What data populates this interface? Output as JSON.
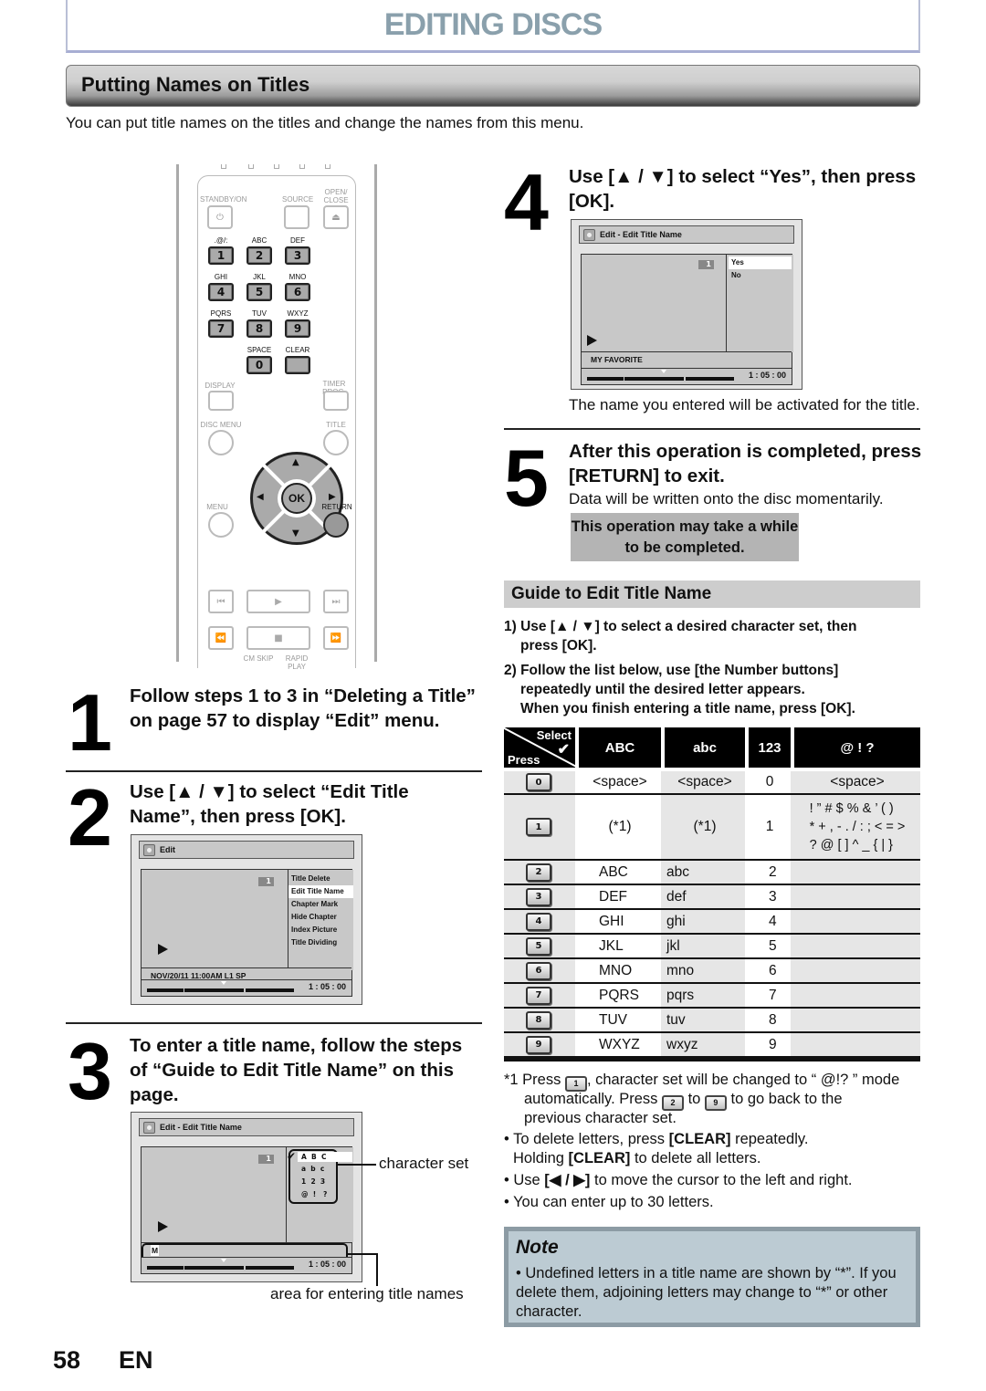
{
  "header": {
    "title": "EDITING DISCS",
    "section_title": "Putting Names on Titles",
    "intro": "You can put title names on the titles and change the names from this menu."
  },
  "remote": {
    "labels": {
      "standby": "STANDBY/ON",
      "source": "SOURCE",
      "open_close_1": "OPEN/",
      "open_close_2": "CLOSE",
      "display": "DISPLAY",
      "timer_prog": "TIMER PROG.",
      "disc_menu": "DISC MENU",
      "title": "TITLE",
      "menu": "MENU",
      "return": "RETURN",
      "ok": "OK",
      "cm_skip": "CM SKIP",
      "rapid_play": "RAPID PLAY"
    },
    "keys": [
      {
        "num": "1",
        "letters": ".@/:"
      },
      {
        "num": "2",
        "letters": "ABC"
      },
      {
        "num": "3",
        "letters": "DEF"
      },
      {
        "num": "4",
        "letters": "GHI"
      },
      {
        "num": "5",
        "letters": "JKL"
      },
      {
        "num": "6",
        "letters": "MNO"
      },
      {
        "num": "7",
        "letters": "PQRS"
      },
      {
        "num": "8",
        "letters": "TUV"
      },
      {
        "num": "9",
        "letters": "WXYZ"
      },
      {
        "num": "0",
        "letters": "SPACE"
      },
      {
        "num": "",
        "letters": "CLEAR"
      }
    ],
    "icons": {
      "power": "⏻",
      "eject": "⏏",
      "up": "▲",
      "down": "▼",
      "left": "◀",
      "right": "▶",
      "prev": "⏮",
      "play": "▶",
      "next": "⏭",
      "rew": "⏪",
      "stop": "■",
      "ff": "⏩"
    }
  },
  "steps": [
    {
      "num": "1",
      "text": "Follow steps 1 to 3 in “Deleting a Title” on page 57 to display “Edit” menu."
    },
    {
      "num": "2",
      "text": "Use [▲ / ▼] to select “Edit Title Name”, then press [OK]."
    },
    {
      "num": "3",
      "text": "To enter a title name, follow the steps of “Guide to Edit Title Name” on this page."
    },
    {
      "num": "4",
      "text": "Use [▲ / ▼] to select “Yes”, then press [OK].",
      "note": "The name you entered will be activated for the title."
    },
    {
      "num": "5",
      "text": "After this operation is completed, press [RETURN] to exit.",
      "note": "Data will be written onto the disc momentarily.",
      "warning": "This operation may take a while to be completed."
    }
  ],
  "osd_edit": {
    "title": "Edit",
    "title_number": "1",
    "menu": [
      "Title Delete",
      "Edit Title Name",
      "Chapter Mark",
      "Hide Chapter",
      "Index Picture",
      "Title Dividing"
    ],
    "selected_index": 1,
    "status": "NOV/20/11 11:00AM L1 SP",
    "time": "1 : 05 : 00"
  },
  "osd_name": {
    "title": "Edit - Edit Title Name",
    "title_number": "1",
    "charset_rows": [
      "A  B  C",
      "a  b  c",
      "1  2  3",
      "@  !   ?"
    ],
    "entry": "M",
    "time": "1 : 05 : 00",
    "callout_charset": "character set",
    "callout_entry": "area for entering title names"
  },
  "osd_confirm": {
    "title": "Edit - Edit Title Name",
    "title_number": "1",
    "options": [
      "Yes",
      "No"
    ],
    "selected_index": 0,
    "status": "MY FAVORITE",
    "time": "1 : 05 : 00"
  },
  "guide": {
    "heading": "Guide to Edit Title Name",
    "lines": [
      "1) Use [▲ / ▼] to select a desired character set, then",
      "press [OK].",
      "2) Follow the list below, use [the Number buttons]",
      "repeatedly until the desired letter appears.",
      "When you finish entering a title name, press [OK]."
    ]
  },
  "char_table": {
    "corner_select": "Select",
    "corner_press": "Press",
    "headers": [
      "ABC",
      "abc",
      "123",
      "@ ! ?"
    ],
    "rows": [
      {
        "key": "0",
        "cells": [
          "<space>",
          "<space>",
          "0",
          "<space>"
        ]
      },
      {
        "key": "1",
        "cells": [
          "(*1)",
          "(*1)",
          "1",
          "! ” # $ % & ’ ( )\n* + , - . / : ; < = >\n? @ [ ] ^ _ { | }"
        ]
      },
      {
        "key": "2",
        "cells": [
          "ABC",
          "abc",
          "2",
          ""
        ]
      },
      {
        "key": "3",
        "cells": [
          "DEF",
          "def",
          "3",
          ""
        ]
      },
      {
        "key": "4",
        "cells": [
          "GHI",
          "ghi",
          "4",
          ""
        ]
      },
      {
        "key": "5",
        "cells": [
          "JKL",
          "jkl",
          "5",
          ""
        ]
      },
      {
        "key": "6",
        "cells": [
          "MNO",
          "mno",
          "6",
          ""
        ]
      },
      {
        "key": "7",
        "cells": [
          "PQRS",
          "pqrs",
          "7",
          ""
        ]
      },
      {
        "key": "8",
        "cells": [
          "TUV",
          "tuv",
          "8",
          ""
        ]
      },
      {
        "key": "9",
        "cells": [
          "WXYZ",
          "wxyz",
          "9",
          ""
        ]
      }
    ]
  },
  "footnotes": {
    "fn1_a": "*1 Press ",
    "fn1_key1": "1",
    "fn1_b": ", character set will be changed to “ @!? ” mode",
    "fn1_c": "automatically. Press ",
    "fn1_key2": "2",
    "fn1_d": " to ",
    "fn1_key3": "9",
    "fn1_e": " to go back to the",
    "fn1_f": "previous character set.",
    "b1_a": "• To delete letters, press ",
    "b1_bold": "[CLEAR]",
    "b1_b": " repeatedly.",
    "b1_c": "Holding ",
    "b1_bold2": "[CLEAR]",
    "b1_d": " to delete all letters.",
    "b2_a": "• Use ",
    "b2_bold": "[◀ / ▶]",
    "b2_b": " to move the cursor to the left and right.",
    "b3": "• You can enter up to 30 letters."
  },
  "note": {
    "title": "Note",
    "text": "• Undefined letters in a title name are shown by “*”. If you delete them, adjoining letters may change to “*” or other character."
  },
  "footer": {
    "page": "58",
    "lang": "EN"
  }
}
